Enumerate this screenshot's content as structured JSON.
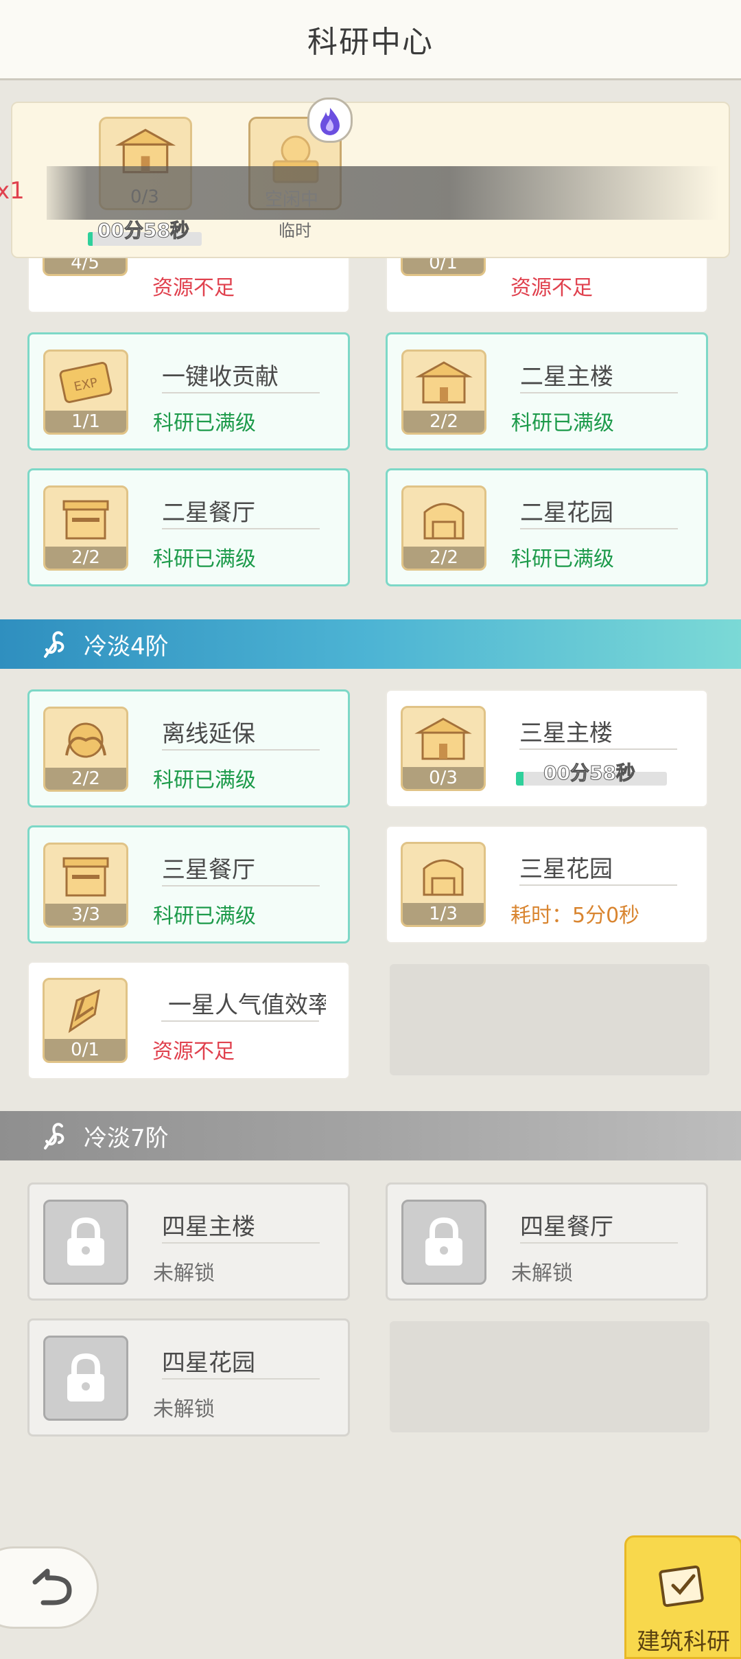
{
  "header": {
    "title": "科研中心"
  },
  "queue": {
    "edge_label": "x1",
    "slot1": {
      "count": "0/3",
      "timer": "00分58秒",
      "progress": 0.03
    },
    "slot2": {
      "status": "空闲中",
      "caption": "临时"
    }
  },
  "top_partial": [
    {
      "count": "4/5",
      "status": "资源不足"
    },
    {
      "count": "0/1",
      "status": "资源不足"
    }
  ],
  "group1_cards": [
    {
      "icon": "exp-ticket-icon",
      "name": "一键收贡献",
      "count": "1/1",
      "status": "科研已满级"
    },
    {
      "icon": "main-building-icon",
      "name": "二星主楼",
      "count": "2/2",
      "status": "科研已满级"
    },
    {
      "icon": "restaurant-icon",
      "name": "二星餐厅",
      "count": "2/2",
      "status": "科研已满级"
    },
    {
      "icon": "garden-icon",
      "name": "二星花园",
      "count": "2/2",
      "status": "科研已满级"
    }
  ],
  "section_4": {
    "title": "冷淡4阶"
  },
  "section4_cards": [
    {
      "icon": "offline-insurance-icon",
      "name": "离线延保",
      "count": "2/2",
      "status": "科研已满级"
    },
    {
      "icon": "main-building-icon",
      "name": "三星主楼",
      "count": "0/3",
      "timer": "00分58秒",
      "progress": 0.03
    },
    {
      "icon": "restaurant-icon",
      "name": "三星餐厅",
      "count": "3/3",
      "status": "科研已满级"
    },
    {
      "icon": "garden-icon",
      "name": "三星花园",
      "count": "1/3",
      "status": "耗时：5分0秒"
    },
    {
      "icon": "popularity-icon",
      "name": "一星人气值效率",
      "count": "0/1",
      "status": "资源不足"
    }
  ],
  "section_7": {
    "title": "冷淡7阶"
  },
  "section7_cards": [
    {
      "icon": "lock-icon",
      "name": "四星主楼",
      "status": "未解锁"
    },
    {
      "icon": "lock-icon",
      "name": "四星餐厅",
      "status": "未解锁"
    },
    {
      "icon": "lock-icon",
      "name": "四星花园",
      "status": "未解锁"
    }
  ],
  "buttons": {
    "back_icon": "back-arrow-icon",
    "build_label": "建筑科研"
  },
  "colors": {
    "section4_bar": "#4aa9c9",
    "section7_bar": "#9a9a9a",
    "maxed_border": "#7dd8c7",
    "green_text": "#1c9a4a",
    "red_text": "#e0414e"
  }
}
